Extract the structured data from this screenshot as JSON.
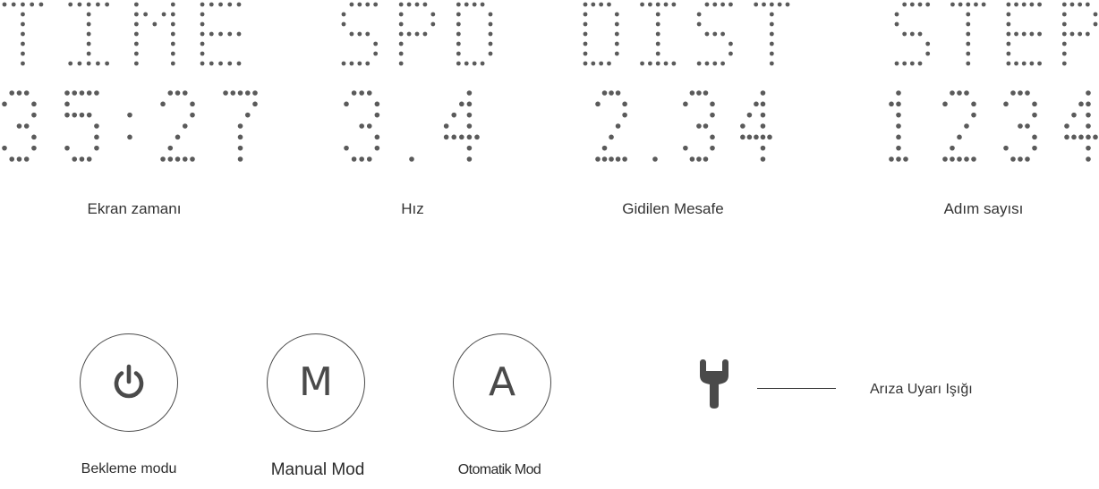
{
  "display": {
    "metrics": [
      {
        "id": "time",
        "header": "TIME",
        "value": "35:27",
        "caption": "Ekran zamanı"
      },
      {
        "id": "speed",
        "header": "SPD",
        "value": "3.4",
        "caption": "Hız"
      },
      {
        "id": "distance",
        "header": "DIST",
        "value": "2.34",
        "caption": "Gidilen Mesafe"
      },
      {
        "id": "steps",
        "header": "STEP",
        "value": "1234",
        "caption": "Adım sayısı"
      }
    ]
  },
  "controls": {
    "buttons": [
      {
        "id": "standby",
        "icon": "power-icon",
        "symbol": "",
        "label": "Bekleme modu"
      },
      {
        "id": "manual",
        "icon": "letter-m-icon",
        "symbol": "M",
        "label": "Manual Mod"
      },
      {
        "id": "auto",
        "icon": "letter-a-icon",
        "symbol": "A",
        "label": "Otomatik Mod"
      }
    ]
  },
  "fault_indicator": {
    "icon": "wrench-icon",
    "label": "Arıza Uyarı Işığı"
  },
  "colors": {
    "dots": "#5a5a5a",
    "outline": "#4a4a4a",
    "text": "#2b2b2b"
  }
}
